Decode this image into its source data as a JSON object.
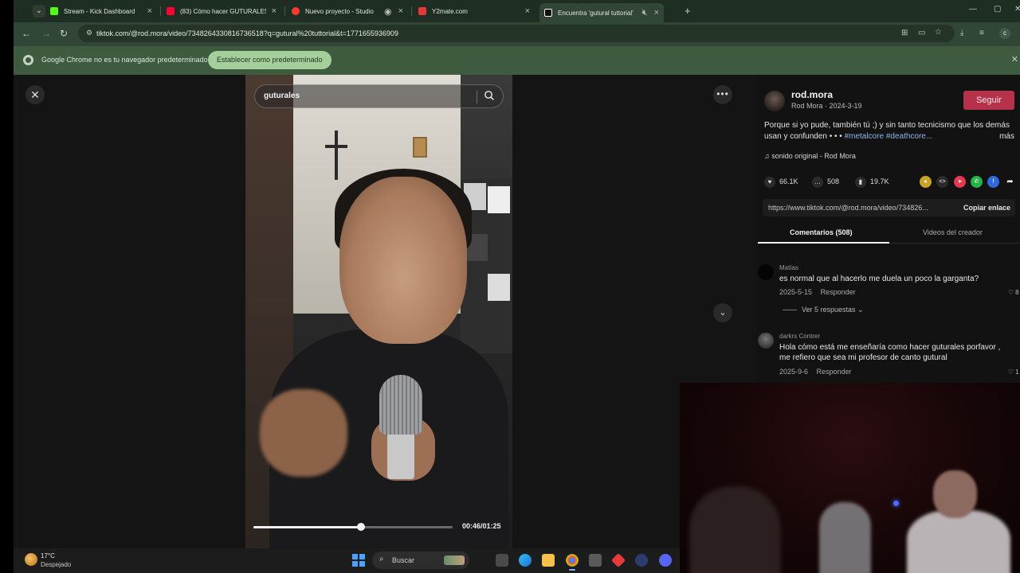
{
  "browser": {
    "tabs": [
      {
        "title": "Stream - Kick Dashboard",
        "favicon_color": "#53fc18",
        "active": false
      },
      {
        "title": "(83) Cómo hacer GUTURALES / ...",
        "favicon_color": "#ff0033",
        "active": false
      },
      {
        "title": "Nuevo proyecto - Studio",
        "favicon_color": "#ff3b30",
        "active": false
      },
      {
        "title": "Y2mate.com",
        "favicon_color": "#e53935",
        "active": false
      },
      {
        "title": "Encuentra 'gutural tuttorial'",
        "favicon_color": "#ffffff",
        "active": true
      }
    ],
    "url": "tiktok.com/@rod.mora/video/7348264330816736518?q=gutural%20tuttorial&t=1771655936909",
    "infobar_message": "Google Chrome no es tu navegador predeterminado",
    "infobar_button": "Establecer como predeterminado",
    "profile_initial": "c"
  },
  "video": {
    "search_query": "guturales",
    "time_display": "00:46/01:25",
    "progress": 0.54
  },
  "post": {
    "username": "rod.mora",
    "nickname_date": "Rod Mora · 2024-3-19",
    "follow_label": "Seguir",
    "description": "Porque si yo pude, también tú ;) y sin tanto tecnicismo que los demás usan y confunden • • •",
    "tags": "#metalcore #deathcore...",
    "more_label": "más",
    "music": "sonido original - Rod Mora",
    "likes": "66.1K",
    "comments_count": "508",
    "saves": "19.7K",
    "link": "https://www.tiktok.com/@rod.mora/video/734826...",
    "copy_label": "Copiar enlace",
    "tab_comments": "Comentarios (508)",
    "tab_creator": "Videos del creador"
  },
  "comments": [
    {
      "name": "Matías",
      "text": "es normal que al hacerlo me duela un poco la garganta?",
      "date": "2025-5-15",
      "reply": "Responder",
      "like_count": "8",
      "replies": "Ver 5 respuestas"
    },
    {
      "name": "darkrs Contrer",
      "text": "Hola cómo está me enseñaría como hacer guturales porfavor , me refiero que sea mi profesor de canto gutural",
      "date": "2025-9-6",
      "reply": "Responder",
      "like_count": "1"
    }
  ],
  "taskbar": {
    "temperature": "17°C",
    "weather": "Despejado",
    "search_label": "Buscar"
  },
  "colors": {
    "accent_follow": "#b6324b",
    "chrome_theme": "#314636",
    "infobar_bg": "#3e5a3f",
    "tag_color": "#8fb3e8"
  }
}
